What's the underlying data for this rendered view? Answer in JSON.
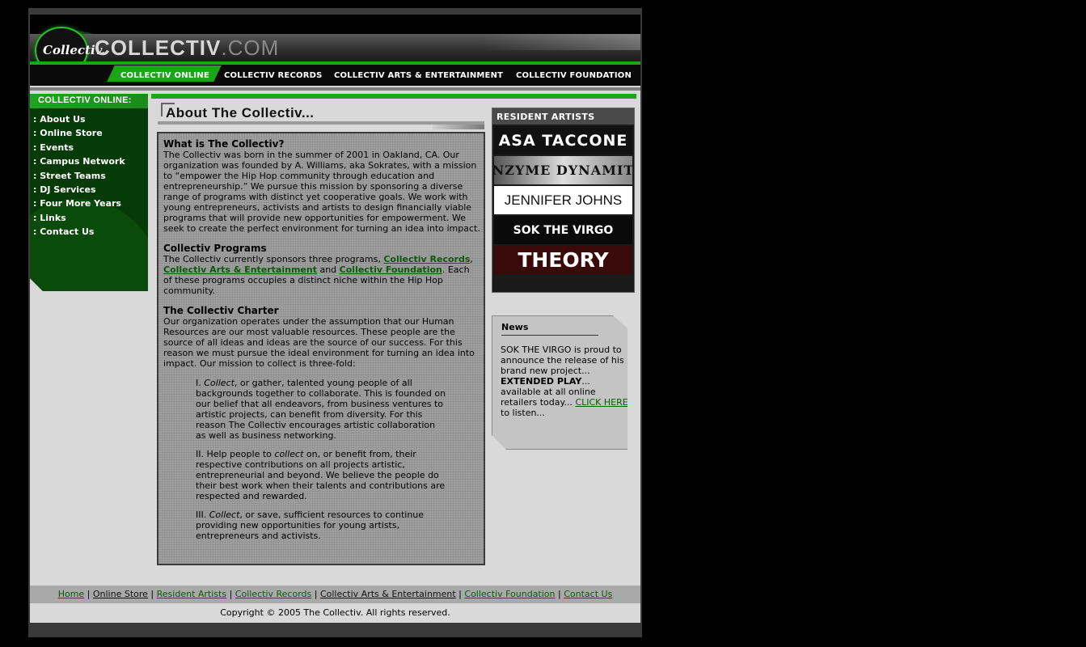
{
  "header": {
    "logo_text": "Collectiv.",
    "site_name": "COLLECTIV",
    "site_domain": ".COM",
    "nav": [
      "COLLECTIV ONLINE",
      "COLLECTIV RECORDS",
      "COLLECTIV ARTS & ENTERTAINMENT",
      "COLLECTIV FOUNDATION"
    ]
  },
  "sidebar": {
    "title": "COLLECTIV ONLINE:",
    "items": [
      ":  About Us",
      ":  Online Store",
      ":  Events",
      ":  Campus Network",
      ":  Street Teams",
      ":  DJ Services",
      ":  Four More Years",
      ":  Links",
      ":  Contact Us"
    ]
  },
  "main": {
    "title": "About The Collectiv...",
    "sec1_heading": "What is The Collectiv?",
    "sec1_body": "The Collectiv was born in the summer of 2001 in Oakland, CA. Our organization was founded by A. Williams, aka Sokrates, with a mission to “empower the Hip Hop community through education and entrepreneurship.” We pursue this mission by sponsoring a diverse range of programs with distinct yet cooperative goals. We work with young entrepreneurs, activists and artists to design financially viable programs that will provide new opportunities for empowerment. We seek to create the perfect environment for turning an idea into impact.",
    "sec2_heading": "Collectiv Programs",
    "sec2_pre": "The Collectiv currently sponsors three programs, ",
    "sec2_link1": "Collectiv Records",
    "sec2_sep1": ", ",
    "sec2_link2": "Collectiv Arts & Entertainment",
    "sec2_sep2": " and ",
    "sec2_link3": "Collectiv Foundation",
    "sec2_post": ". Each of these programs occupies a distinct niche within the Hip Hop community.",
    "sec3_heading": "The Collectiv Charter",
    "sec3_body": "Our organization operates under the assumption that our Human Resources are our most valuable resources. These people are the source of all ideas and ideas are the source of our success. For this reason we must pursue the ideal environment for turning an idea into impact. Our mission to collect is three-fold:",
    "point1_num": "I. ",
    "point1_em": "Collect",
    "point1_text": ", or gather, talented young people of all backgrounds together to collaborate. This is founded on our belief that all endeavors, from business ventures to artistic projects, can benefit from diversity. For this reason The Collectiv encourages artistic collaboration as well as business networking.",
    "point2_pre": "II. Help people to ",
    "point2_em": "collect",
    "point2_text": " on, or benefit from, their respective contributions on all projects artistic, entrepreneurial and beyond. We believe the people do their best work when their talents and contributions are respected and rewarded.",
    "point3_num": "III. ",
    "point3_em": "Collect",
    "point3_text": ", or save, sufficient resources to continue providing new opportunities for young artists, entrepreneurs and activists."
  },
  "resident": {
    "title": "RESIDENT ARTISTS",
    "artists": [
      "ASA TACCONE",
      "ENZYME DYNAMITE",
      "JENNIFER JOHNS",
      "SOK THE VIRGO",
      "THEORY"
    ]
  },
  "news": {
    "title": "News",
    "text1": "SOK THE VIRGO is proud to announce the release of his brand new project...",
    "bold": "EXTENDED PLAY",
    "text2": "... available at all online retailers today... ",
    "link": "CLICK HERE",
    "text3": " to listen..."
  },
  "footer": {
    "links": [
      "Home",
      "Online Store",
      "Resident Artists",
      "Collectiv Records",
      "Collectiv Arts & Entertainment",
      "Collectiv Foundation",
      "Contact Us"
    ],
    "separator": " | ",
    "copyright": "Copyright © 2005 The Collectiv. All rights reserved."
  },
  "colors": {
    "brand_green": "#1aa51a",
    "sidebar_green": "#063a06",
    "link_green": "#0a5a0a",
    "background": "#000000"
  }
}
